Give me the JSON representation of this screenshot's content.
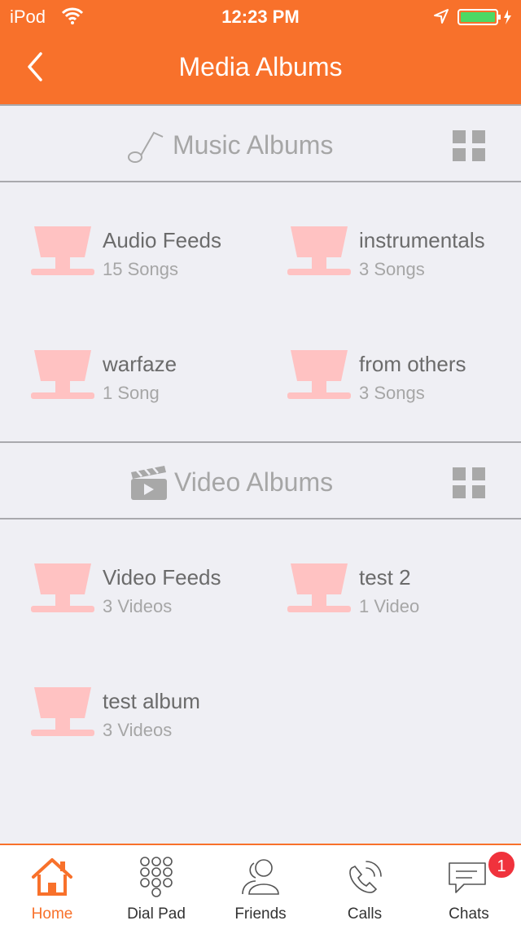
{
  "status_bar": {
    "carrier": "iPod",
    "time": "12:23 PM"
  },
  "header": {
    "title": "Media Albums"
  },
  "music_section": {
    "title": "Music Albums",
    "albums": [
      {
        "name": "Audio Feeds",
        "count": "15 Songs"
      },
      {
        "name": "instrumentals",
        "count": "3 Songs"
      },
      {
        "name": "warfaze",
        "count": "1 Song"
      },
      {
        "name": "from others",
        "count": "3 Songs"
      }
    ]
  },
  "video_section": {
    "title": "Video Albums",
    "albums": [
      {
        "name": "Video Feeds",
        "count": "3 Videos"
      },
      {
        "name": "test 2",
        "count": "1 Video"
      },
      {
        "name": "test album",
        "count": "3 Videos"
      }
    ]
  },
  "tab_bar": {
    "tabs": [
      {
        "label": "Home",
        "icon": "home-icon",
        "active": true
      },
      {
        "label": "Dial Pad",
        "icon": "dial-pad-icon"
      },
      {
        "label": "Friends",
        "icon": "friends-icon"
      },
      {
        "label": "Calls",
        "icon": "calls-icon"
      },
      {
        "label": "Chats",
        "icon": "chats-icon",
        "badge": "1"
      }
    ]
  },
  "colors": {
    "accent": "#f8712b",
    "album_icon": "#ffc2c2",
    "background": "#efeff4",
    "badge": "#f0323c"
  }
}
